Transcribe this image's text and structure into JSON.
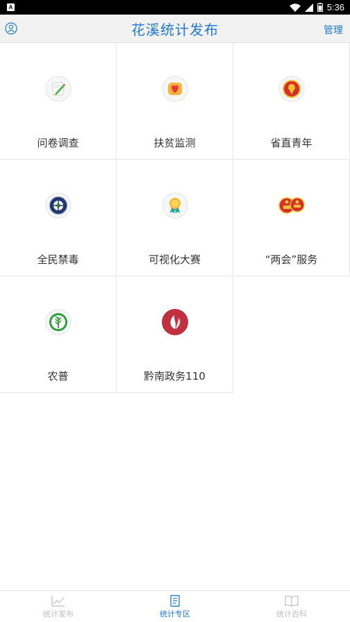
{
  "status_bar": {
    "notification_glyph": "A",
    "time": "5:36",
    "icons": [
      "wifi-icon",
      "cell-signal-icon",
      "battery-icon"
    ]
  },
  "header": {
    "title": "花溪统计发布",
    "manage_label": "管理",
    "left_icon": "user-icon"
  },
  "grid": {
    "items": [
      {
        "label": "问卷调查",
        "icon": "questionnaire-pencil-icon"
      },
      {
        "label": "扶贫监测",
        "icon": "poverty-heart-icon"
      },
      {
        "label": "省直青年",
        "icon": "youth-league-emblem-icon"
      },
      {
        "label": "全民禁毒",
        "icon": "anti-drug-emblem-icon"
      },
      {
        "label": "可视化大赛",
        "icon": "award-medal-icon"
      },
      {
        "label": "“两会”服务",
        "icon": "two-sessions-emblems-icon"
      },
      {
        "label": "农普",
        "icon": "agriculture-census-icon"
      },
      {
        "label": "黔南政务110",
        "icon": "leaf-logo-icon"
      }
    ]
  },
  "tabs": [
    {
      "label": "统计发布",
      "icon": "line-chart-icon",
      "active": false
    },
    {
      "label": "统计专区",
      "icon": "document-icon",
      "active": true
    },
    {
      "label": "统计百科",
      "icon": "open-book-icon",
      "active": false
    }
  ],
  "colors": {
    "accent": "#1f78c9",
    "header_bg": "#f2f2f2",
    "tab_inactive": "#bdbdbd",
    "label_text": "#333333"
  }
}
